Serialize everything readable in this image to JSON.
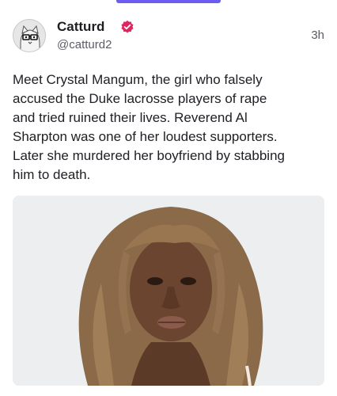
{
  "post": {
    "author_name": "Catturd",
    "handle": "@catturd2",
    "timestamp": "3h",
    "text": "Meet Crystal Mangum, the girl who falsely\naccused the Duke lacrosse players of rape\nand tried ruined their lives. Reverend Al\nSharpton was one of her loudest supporters.\nLater she murdered her boyfriend by stabbing\nhim to death."
  },
  "icons": {
    "verified": "verified-badge-icon",
    "avatar": "cat-avatar"
  },
  "colors": {
    "accent": "#6d5cf0",
    "verified": "#e0245e",
    "text": "#202026",
    "muted": "#5b5b66"
  }
}
